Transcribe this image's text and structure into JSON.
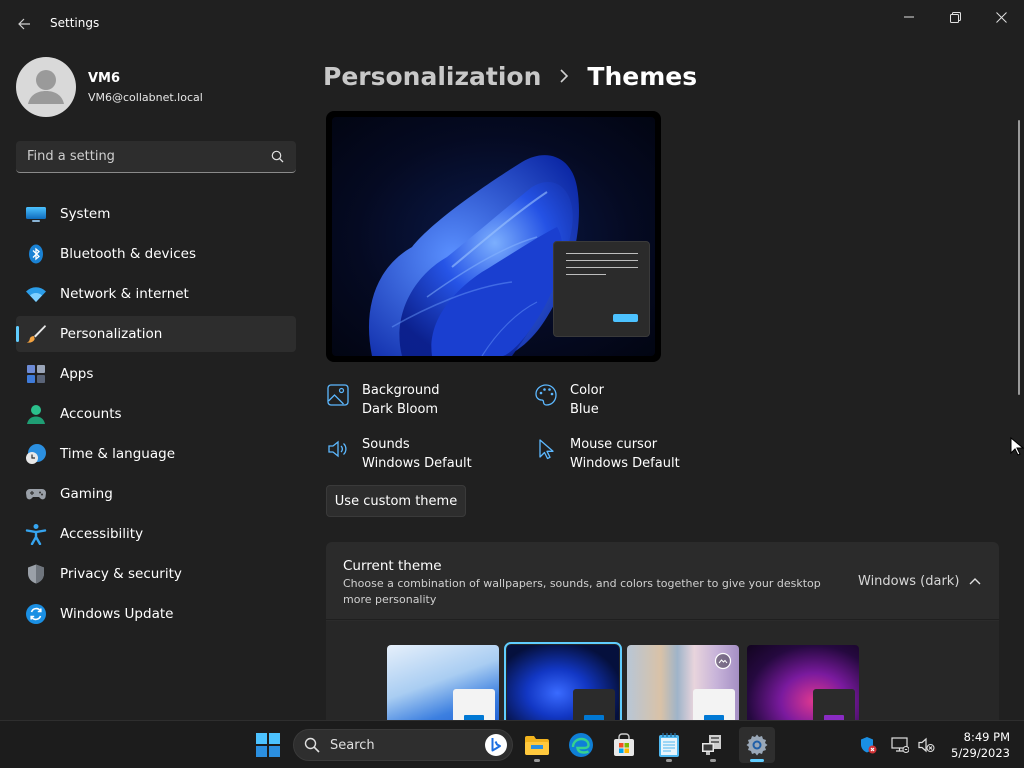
{
  "window": {
    "title": "Settings"
  },
  "profile": {
    "name": "VM6",
    "email": "VM6@collabnet.local"
  },
  "search": {
    "placeholder": "Find a setting"
  },
  "nav": {
    "items": [
      {
        "label": "System",
        "icon": "system-icon"
      },
      {
        "label": "Bluetooth & devices",
        "icon": "bluetooth-icon"
      },
      {
        "label": "Network & internet",
        "icon": "wifi-icon"
      },
      {
        "label": "Personalization",
        "icon": "brush-icon",
        "active": true
      },
      {
        "label": "Apps",
        "icon": "apps-icon"
      },
      {
        "label": "Accounts",
        "icon": "accounts-icon"
      },
      {
        "label": "Time & language",
        "icon": "clock-globe-icon"
      },
      {
        "label": "Gaming",
        "icon": "gamepad-icon"
      },
      {
        "label": "Accessibility",
        "icon": "accessibility-icon"
      },
      {
        "label": "Privacy & security",
        "icon": "shield-icon"
      },
      {
        "label": "Windows Update",
        "icon": "update-icon"
      }
    ]
  },
  "breadcrumb": {
    "parent": "Personalization",
    "current": "Themes"
  },
  "theme_props": {
    "background": {
      "label": "Background",
      "value": "Dark Bloom"
    },
    "color": {
      "label": "Color",
      "value": "Blue"
    },
    "sounds": {
      "label": "Sounds",
      "value": "Windows Default"
    },
    "cursor": {
      "label": "Mouse cursor",
      "value": "Windows Default"
    }
  },
  "custom_theme_button": "Use custom theme",
  "current_theme": {
    "title": "Current theme",
    "description": "Choose a combination of wallpapers, sounds, and colors together to give your desktop more personality",
    "value": "Windows (dark)"
  },
  "taskbar": {
    "search_label": "Search",
    "time": "8:49 PM",
    "date": "5/29/2023"
  },
  "colors": {
    "accent": "#60cdff",
    "background": "#202020",
    "card": "#2b2b2b"
  }
}
